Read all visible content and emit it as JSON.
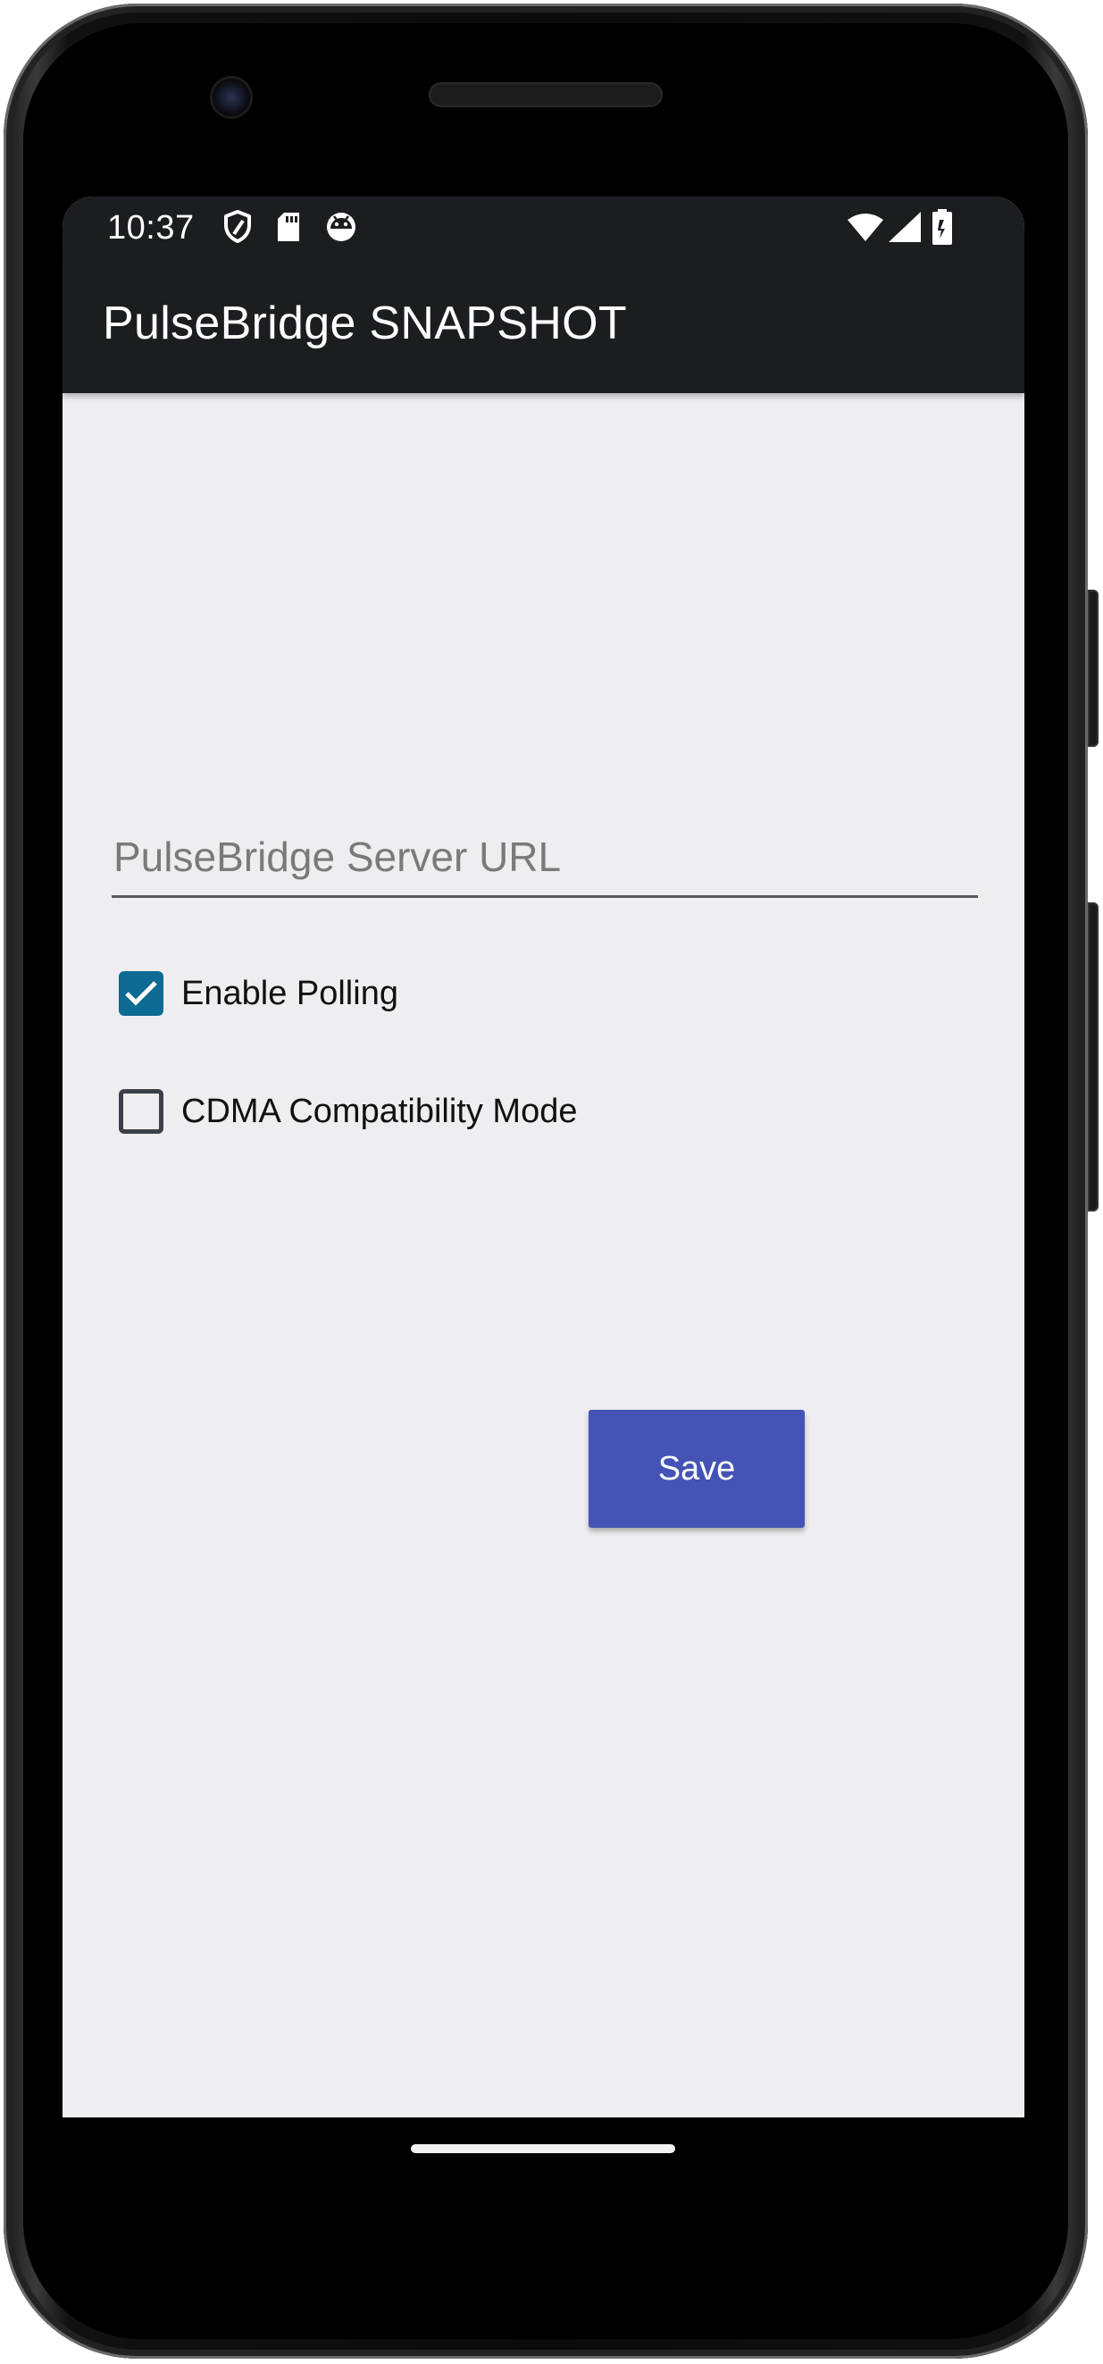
{
  "status_bar": {
    "time": "10:37",
    "icons_left": [
      "shield-icon",
      "sd-card-icon",
      "android-debug-icon"
    ],
    "icons_right": [
      "wifi-icon",
      "cell-signal-icon",
      "battery-icon"
    ]
  },
  "app_bar": {
    "title": "PulseBridge SNAPSHOT"
  },
  "form": {
    "server_url": {
      "value": "",
      "placeholder": "PulseBridge Server URL"
    },
    "enable_polling": {
      "label": "Enable Polling",
      "checked": true
    },
    "cdma_mode": {
      "label": "CDMA Compatibility Mode",
      "checked": false
    },
    "save_label": "Save"
  },
  "colors": {
    "app_bar": "#1b1d20",
    "background": "#eeeef0",
    "checkbox_checked": "#0d6b93",
    "save_button": "#4453b5"
  }
}
